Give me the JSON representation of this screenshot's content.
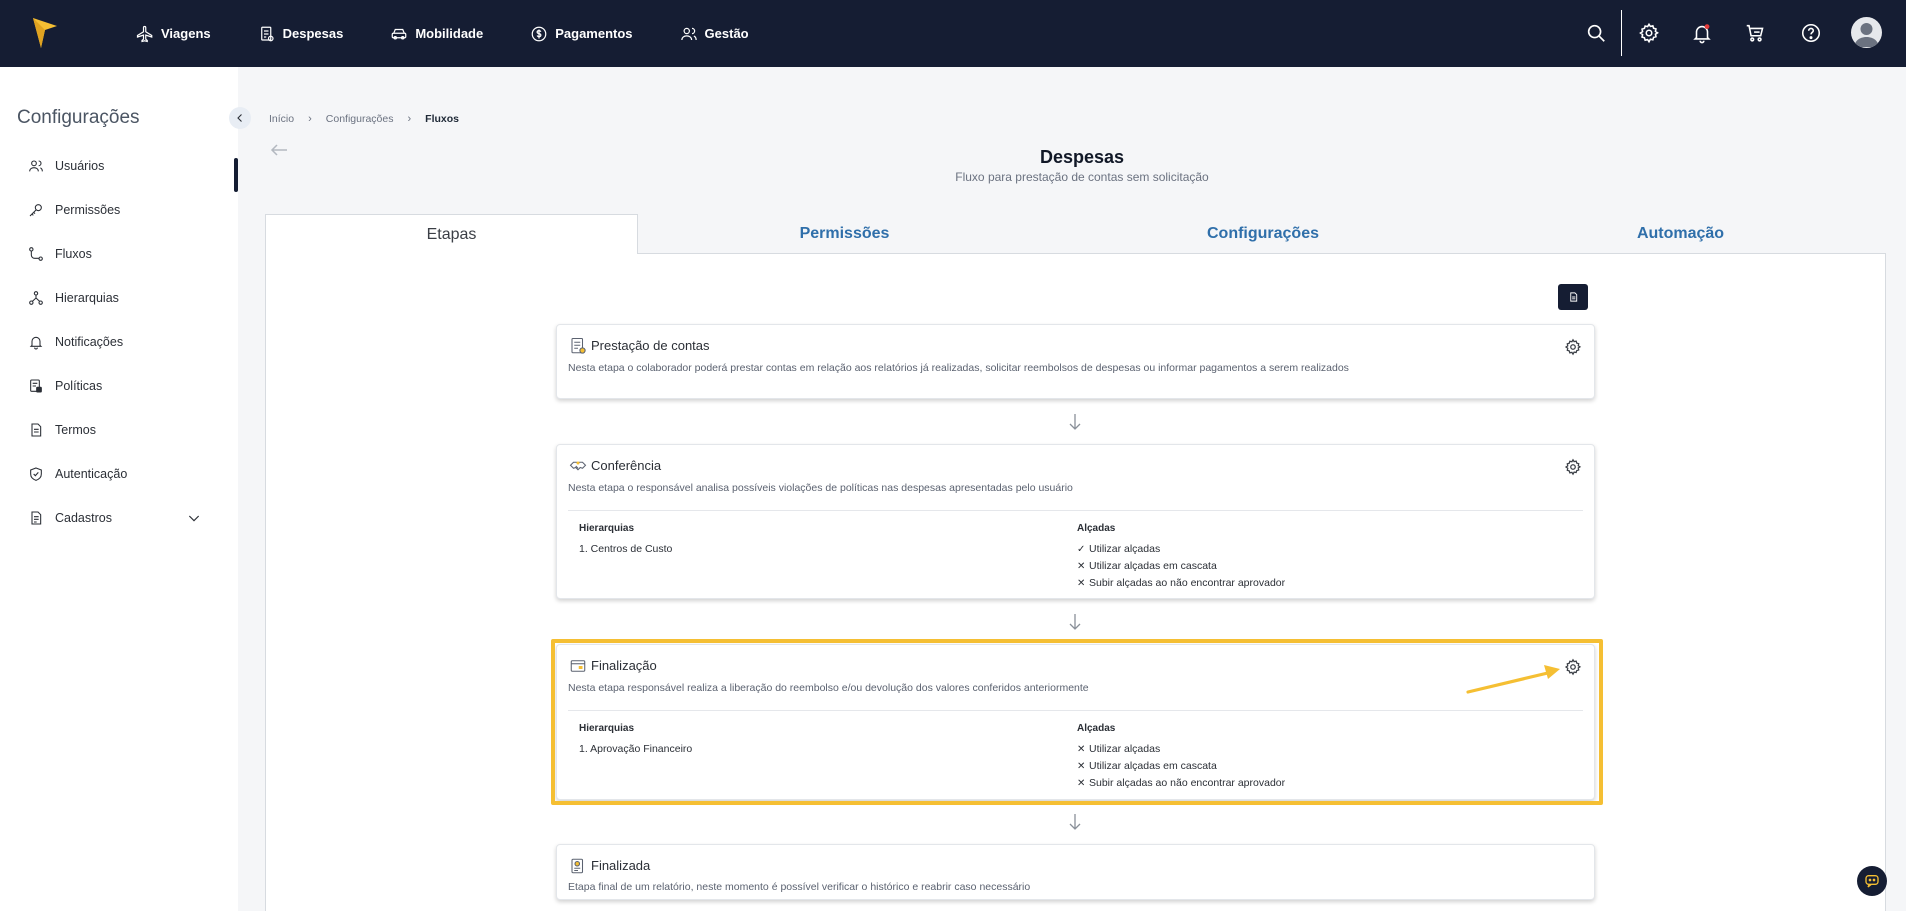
{
  "colors": {
    "topbar": "#151d33",
    "accent_link": "#2f6faa",
    "highlight": "#f5bf33",
    "logo": "#f5bf33",
    "notification_dot": "#e23b3b"
  },
  "topbar": {
    "nav": [
      {
        "label": "Viagens",
        "icon": "plane-icon"
      },
      {
        "label": "Despesas",
        "icon": "receipt-icon"
      },
      {
        "label": "Mobilidade",
        "icon": "car-icon"
      },
      {
        "label": "Pagamentos",
        "icon": "dollar-circle-icon"
      },
      {
        "label": "Gestão",
        "icon": "users-icon"
      }
    ],
    "icons": [
      "search-icon",
      "gear-icon",
      "bell-icon",
      "cart-icon",
      "help-icon",
      "avatar"
    ]
  },
  "sidebar": {
    "title": "Configurações",
    "items": [
      {
        "label": "Usuários",
        "icon": "users-icon"
      },
      {
        "label": "Permissões",
        "icon": "key-icon"
      },
      {
        "label": "Fluxos",
        "icon": "flow-icon"
      },
      {
        "label": "Hierarquias",
        "icon": "hierarchy-icon"
      },
      {
        "label": "Notificações",
        "icon": "bell-icon"
      },
      {
        "label": "Políticas",
        "icon": "policy-icon"
      },
      {
        "label": "Termos",
        "icon": "document-icon"
      },
      {
        "label": "Autenticação",
        "icon": "shield-icon"
      },
      {
        "label": "Cadastros",
        "icon": "file-icon"
      }
    ]
  },
  "breadcrumb": [
    "Início",
    "Configurações",
    "Fluxos"
  ],
  "page": {
    "title": "Despesas",
    "subtitle": "Fluxo para prestação de contas sem solicitação"
  },
  "tabs": [
    "Etapas",
    "Permissões",
    "Configurações",
    "Automação"
  ],
  "steps": [
    {
      "title": "Prestação de contas",
      "description": "Nesta etapa o colaborador poderá prestar contas em relação aos relatórios já realizadas, solicitar reembolsos de despesas ou informar pagamentos a serem realizados"
    },
    {
      "title": "Conferência",
      "description": "Nesta etapa o responsável analisa possíveis violações de políticas nas despesas apresentadas pelo usuário",
      "hierarchies_label": "Hierarquias",
      "hierarchies": [
        "1. Centros de Custo"
      ],
      "thresholds_label": "Alçadas",
      "thresholds": [
        {
          "mark": "✓",
          "label": "Utilizar alçadas"
        },
        {
          "mark": "✕",
          "label": "Utilizar alçadas em cascata"
        },
        {
          "mark": "✕",
          "label": "Subir alçadas ao não encontrar aprovador"
        }
      ]
    },
    {
      "title": "Finalização",
      "description": "Nesta etapa responsável realiza a liberação do reembolso e/ou devolução dos valores conferidos anteriormente",
      "hierarchies_label": "Hierarquias",
      "hierarchies": [
        "1. Aprovação Financeiro"
      ],
      "thresholds_label": "Alçadas",
      "thresholds": [
        {
          "mark": "✕",
          "label": "Utilizar alçadas"
        },
        {
          "mark": "✕",
          "label": "Utilizar alçadas em cascata"
        },
        {
          "mark": "✕",
          "label": "Subir alçadas ao não encontrar aprovador"
        }
      ]
    },
    {
      "title": "Finalizada",
      "description": "Etapa final de um relatório, neste momento é possível verificar o histórico e reabrir caso necessário"
    }
  ]
}
